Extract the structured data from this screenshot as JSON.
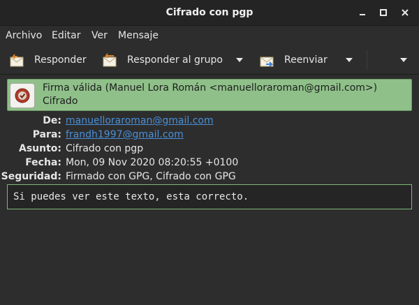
{
  "window": {
    "title": "Cifrado con pgp"
  },
  "menubar": {
    "items": [
      "Archivo",
      "Editar",
      "Ver",
      "Mensaje"
    ]
  },
  "toolbar": {
    "reply_label": "Responder",
    "reply_group_label": "Responder al grupo",
    "forward_label": "Reenviar"
  },
  "signature": {
    "status_line": "Firma válida (Manuel Lora Román <manuelloraroman@gmail.com>)",
    "encryption_line": "Cifrado",
    "color": "#8fc089"
  },
  "headers": {
    "from_label": "De:",
    "from_value": "manuelloraroman@gmail.com",
    "to_label": "Para:",
    "to_value": "frandh1997@gmail.com",
    "subject_label": "Asunto:",
    "subject_value": "Cifrado con pgp",
    "date_label": "Fecha:",
    "date_value": "Mon, 09 Nov 2020 08:20:55 +0100",
    "security_label": "Seguridad:",
    "security_value": "Firmado con GPG, Cifrado con GPG"
  },
  "body": {
    "text": "Si puedes ver este texto, esta correcto."
  },
  "icons": {
    "reply": "reply-envelope-icon",
    "reply_group": "reply-group-envelope-icon",
    "forward": "forward-envelope-icon",
    "signature": "seal-icon"
  }
}
